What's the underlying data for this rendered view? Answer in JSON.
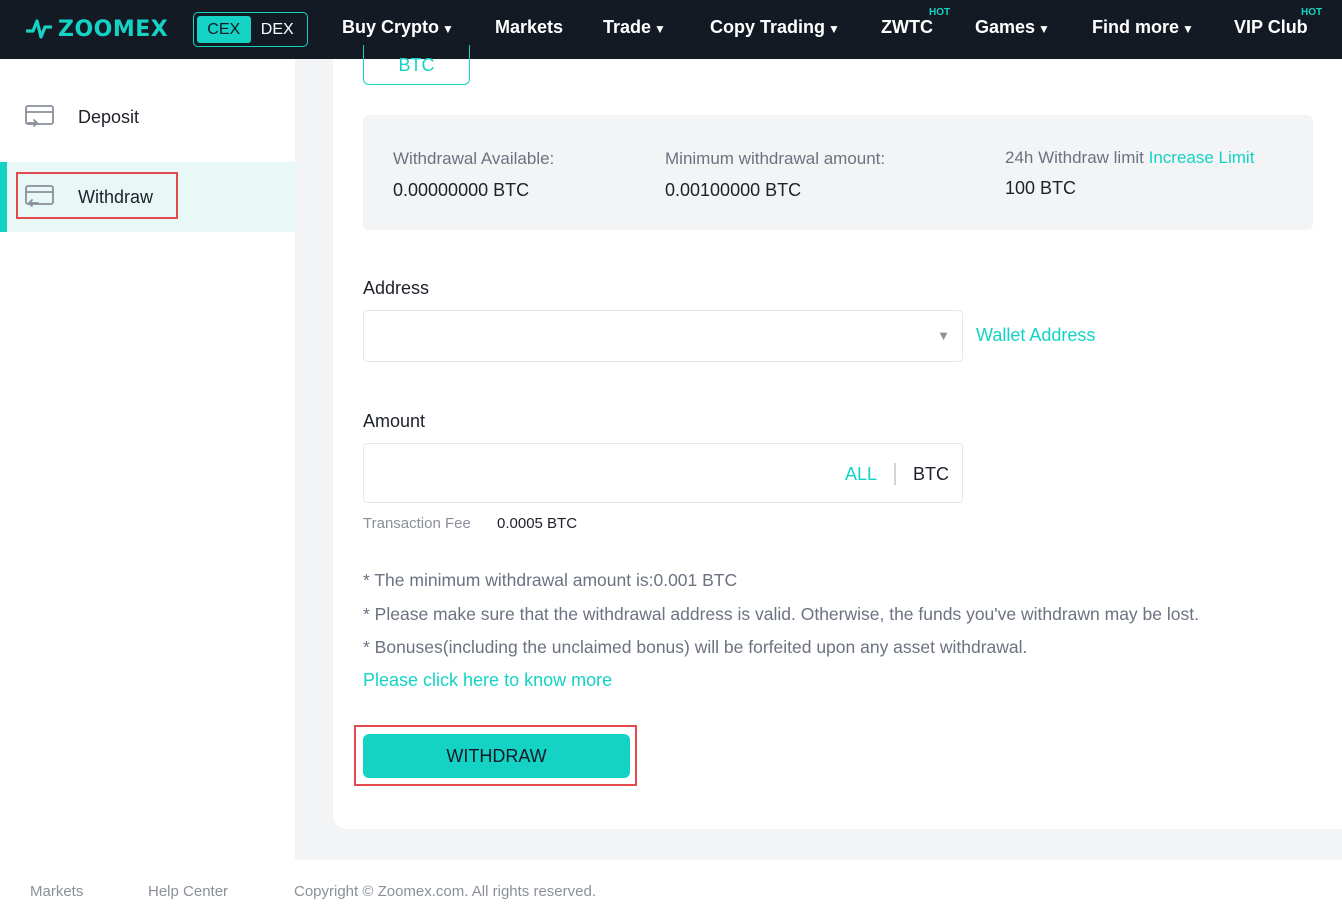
{
  "brand": {
    "name": "ZOOMEX",
    "accent": "#14d3c5",
    "nav_bg": "#141a24",
    "icon": "zoomex-logo-icon"
  },
  "mode_switch": {
    "cex": "CEX",
    "dex": "DEX",
    "selected": "CEX"
  },
  "nav": {
    "buy_crypto": "Buy Crypto",
    "markets": "Markets",
    "trade": "Trade",
    "copy_trading": "Copy Trading",
    "zwtc": "ZWTC",
    "zwtc_badge": "HOT",
    "games": "Games",
    "find_more": "Find more",
    "vip_club": "VIP Club",
    "vip_badge": "HOT"
  },
  "sidebar": {
    "items": [
      {
        "label": "Deposit",
        "icon": "deposit-card-icon",
        "active": false
      },
      {
        "label": "Withdraw",
        "icon": "withdraw-card-icon",
        "active": true
      }
    ]
  },
  "coin": {
    "selected": "BTC"
  },
  "info": {
    "available_label": "Withdrawal Available:",
    "available_value": "0.00000000 BTC",
    "minimum_label": "Minimum withdrawal amount:",
    "minimum_value": "0.00100000 BTC",
    "limit_label": "24h Withdraw limit",
    "increase_limit": "Increase Limit",
    "limit_value": "100 BTC"
  },
  "address": {
    "label": "Address",
    "value": "",
    "wallet_link": "Wallet Address"
  },
  "amount": {
    "label": "Amount",
    "value": "",
    "all": "ALL",
    "unit": "BTC"
  },
  "fee": {
    "label": "Transaction Fee",
    "value": "0.0005 BTC"
  },
  "notes": [
    "* The minimum withdrawal amount is:0.001 BTC",
    "* Please make sure that the withdrawal address is valid. Otherwise, the funds you've withdrawn may be lost.",
    "* Bonuses(including the unclaimed bonus) will be forfeited upon any asset withdrawal."
  ],
  "more_link": "Please click here to know more",
  "submit": "WITHDRAW",
  "footer": {
    "markets": "Markets",
    "help_center": "Help Center",
    "copyright": "Copyright © Zoomex.com. All rights reserved."
  }
}
